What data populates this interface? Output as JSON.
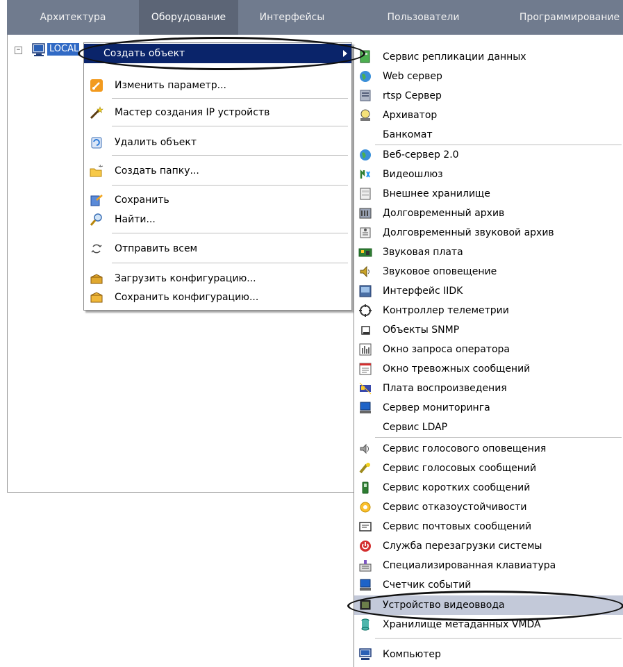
{
  "tabs": [
    {
      "label": "Архитектура",
      "active": false
    },
    {
      "label": "Оборудование",
      "active": true
    },
    {
      "label": "Интерфейсы",
      "active": false
    },
    {
      "label": "Пользователи",
      "active": false
    },
    {
      "label": "Программирование",
      "active": false
    }
  ],
  "tree": {
    "toggle": "−",
    "node_label": "LOCAL"
  },
  "context_menu": {
    "items": [
      {
        "label": "Создать объект",
        "icon": "none"
      },
      {
        "label": "Изменить параметр...",
        "icon": "edit-param-icon"
      },
      {
        "label": "Мастер создания IP устройств",
        "icon": "wand-icon"
      },
      {
        "label": "Удалить объект",
        "icon": "delete-icon"
      },
      {
        "label": "Создать папку...",
        "icon": "folder-new-icon"
      },
      {
        "label": "Сохранить",
        "icon": "save-icon"
      },
      {
        "label": "Найти...",
        "icon": "search-icon"
      },
      {
        "label": "Отправить всем",
        "icon": "refresh-icon"
      },
      {
        "label": "Загрузить конфигурацию...",
        "icon": "load-config-icon"
      },
      {
        "label": "Сохранить конфигурацию...",
        "icon": "save-config-icon"
      }
    ]
  },
  "sub_menu": {
    "items": [
      {
        "label": "Сервис репликации данных",
        "icon": "replication-icon"
      },
      {
        "label": "Web сервер",
        "icon": "globe-icon"
      },
      {
        "label": "rtsp Сервер",
        "icon": "rtsp-server-icon"
      },
      {
        "label": "Архиватор",
        "icon": "archiver-icon"
      },
      {
        "label": "Банкомат",
        "icon": "none"
      },
      {
        "label": "Веб-сервер 2.0",
        "icon": "globe-icon"
      },
      {
        "label": "Видеошлюз",
        "icon": "video-gateway-icon"
      },
      {
        "label": "Внешнее хранилище",
        "icon": "external-storage-icon"
      },
      {
        "label": "Долговременный архив",
        "icon": "long-archive-icon"
      },
      {
        "label": "Долговременный звуковой архив",
        "icon": "sound-archive-icon"
      },
      {
        "label": "Звуковая плата",
        "icon": "sound-card-icon"
      },
      {
        "label": "Звуковое оповещение",
        "icon": "sound-alert-icon"
      },
      {
        "label": "Интерфейс IIDK",
        "icon": "iidk-icon"
      },
      {
        "label": "Контроллер телеметрии",
        "icon": "telemetry-icon"
      },
      {
        "label": "Объекты SNMP",
        "icon": "snmp-icon"
      },
      {
        "label": "Окно запроса оператора",
        "icon": "operator-request-icon"
      },
      {
        "label": "Окно тревожных сообщений",
        "icon": "alarm-window-icon"
      },
      {
        "label": "Плата воспроизведения",
        "icon": "playback-board-icon"
      },
      {
        "label": "Сервер мониторинга",
        "icon": "monitoring-server-icon"
      },
      {
        "label": "Сервис LDAP",
        "icon": "none"
      },
      {
        "label": "Сервис голосового оповещения",
        "icon": "voice-alert-icon"
      },
      {
        "label": "Сервис голосовых сообщений",
        "icon": "voice-messages-icon"
      },
      {
        "label": "Сервис коротких сообщений",
        "icon": "sms-icon"
      },
      {
        "label": "Сервис отказоустойчивости",
        "icon": "failover-icon"
      },
      {
        "label": "Сервис почтовых сообщений",
        "icon": "mail-icon"
      },
      {
        "label": "Служба перезагрузки системы",
        "icon": "power-icon"
      },
      {
        "label": "Специализированная клавиатура",
        "icon": "keyboard-icon"
      },
      {
        "label": "Счетчик событий",
        "icon": "event-counter-icon"
      },
      {
        "label": "Устройство видеоввода",
        "icon": "video-input-icon"
      },
      {
        "label": "Хранилище метаданных VMDA",
        "icon": "vmda-icon"
      },
      {
        "label": "Компьютер",
        "icon": "computer-icon"
      }
    ]
  },
  "colors": {
    "tabbar": "#707b8e",
    "tab_active": "#5c6576",
    "menu_highlight": "#0a246a",
    "submenu_selected": "#c3c9d9",
    "tree_selected": "#316ac5"
  }
}
